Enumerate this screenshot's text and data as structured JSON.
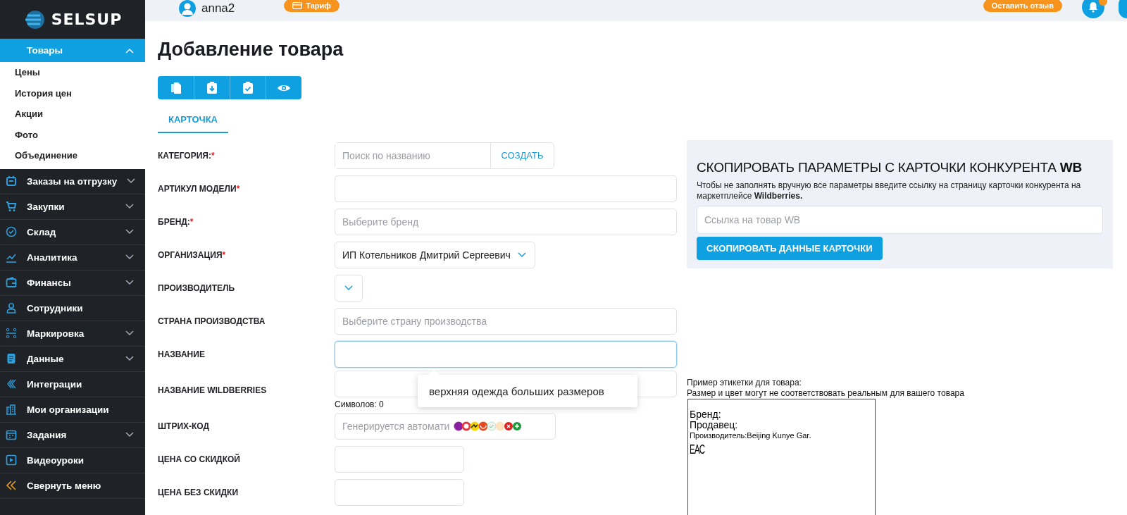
{
  "sidebar": {
    "logo": "SELSUP",
    "menu": [
      {
        "label": "Товары",
        "selected": true,
        "expandable": true,
        "expanded": true,
        "children": [
          {
            "label": "Цены",
            "selected": false
          },
          {
            "label": "История цен",
            "selected": false
          },
          {
            "label": "Акции",
            "selected": false
          },
          {
            "label": "Фото",
            "selected": false
          },
          {
            "label": "Объединение",
            "selected": false
          }
        ]
      },
      {
        "label": "Заказы на отгрузку",
        "selected": false,
        "expandable": true,
        "expanded": false
      },
      {
        "label": "Закупки",
        "selected": false,
        "expandable": true,
        "expanded": false
      },
      {
        "label": "Склад",
        "selected": false,
        "expandable": true,
        "expanded": false
      },
      {
        "label": "Аналитика",
        "selected": false,
        "expandable": true,
        "expanded": false
      },
      {
        "label": "Финансы",
        "selected": false,
        "expandable": true,
        "expanded": false
      },
      {
        "label": "Сотрудники",
        "selected": false,
        "expandable": false
      },
      {
        "label": "Маркировка",
        "selected": false,
        "expandable": true,
        "expanded": false
      },
      {
        "label": "Данные",
        "selected": false,
        "expandable": true,
        "expanded": false
      },
      {
        "label": "Интеграции",
        "selected": false,
        "expandable": false
      },
      {
        "label": "Мои организации",
        "selected": false,
        "expandable": false
      },
      {
        "label": "Задания",
        "selected": false,
        "expandable": true,
        "expanded": false
      },
      {
        "label": "Видеоуроки",
        "selected": false,
        "expandable": false
      }
    ],
    "collapse": "Свернуть меню"
  },
  "topbar": {
    "user": "anna2",
    "tariff_button": "Тариф",
    "feedback_button": "Оставить отзыв"
  },
  "title": "Добавление товара",
  "tabs": [
    {
      "label": "КАРТОЧКА",
      "selected": true
    }
  ],
  "fields": [
    {
      "kind": "search",
      "label": "КАТЕГОРИЯ:",
      "required_mark": "*",
      "placeholder": "Поиск по названию",
      "button": "СОЗДАТЬ",
      "focused": false
    },
    {
      "kind": "text",
      "label": "АРТИКУЛ МОДЕЛИ",
      "required_mark": "*",
      "focused": false
    },
    {
      "kind": "text",
      "label": "БРЕНД:",
      "required_mark": "*",
      "placeholder": "Выберите бренд",
      "focused": false
    },
    {
      "kind": "select",
      "label": "ОРГАНИЗАЦИЯ",
      "required_mark": "*",
      "value": "ИП Котельников Дмитрий Сергеевич",
      "focused": false
    },
    {
      "kind": "select",
      "label": "ПРОИЗВОДИТЕЛЬ",
      "focused": false
    },
    {
      "kind": "text",
      "label": "СТРАНА ПРОИЗВОДСТВА",
      "placeholder": "Выберите страну производства",
      "focused": false
    },
    {
      "kind": "text",
      "label": "НАЗВАНИЕ",
      "focused": true
    },
    {
      "kind": "text",
      "label": "НАЗВАНИЕ WILDBERRIES",
      "counter": "Символов: 0",
      "tooltip": "верхняя одежда больших размеров",
      "focused": false
    },
    {
      "kind": "barcode",
      "label": "ШТРИХ-КОД",
      "placeholder": "Генерируется автомати",
      "focused": false
    },
    {
      "kind": "short",
      "label": "ЦЕНА СО СКИДКОЙ",
      "focused": false
    },
    {
      "kind": "short",
      "label": "ЦЕНА БЕЗ СКИДКИ",
      "focused": false
    }
  ],
  "copy_panel": {
    "title": "СКОПИРОВАТЬ ПАРАМЕТРЫ С КАРТОЧКИ КОНКУРЕНТА **WB**",
    "description": "Чтобы не заполнять вручную все параметры введите ссылку на страницу карточки конкурента на маркетплейсе **Wildberries.**",
    "placeholder": "Ссылка на товар WB",
    "button": "СКОПИРОВАТЬ ДАННЫЕ КАРТОЧКИ"
  },
  "label_example": {
    "caption": [
      "Пример этикетки для товара:",
      "Размер и цвет могут не соответствовать реальным для вашего товара"
    ],
    "lines": [
      {
        "kind": "large",
        "text": "Бренд:"
      },
      {
        "kind": "large",
        "text": "Продавец:"
      },
      {
        "kind": "small",
        "text": "Производитель:Beijing Kunye Gar."
      },
      {
        "kind": "mark",
        "text": "ЕАС"
      }
    ]
  }
}
